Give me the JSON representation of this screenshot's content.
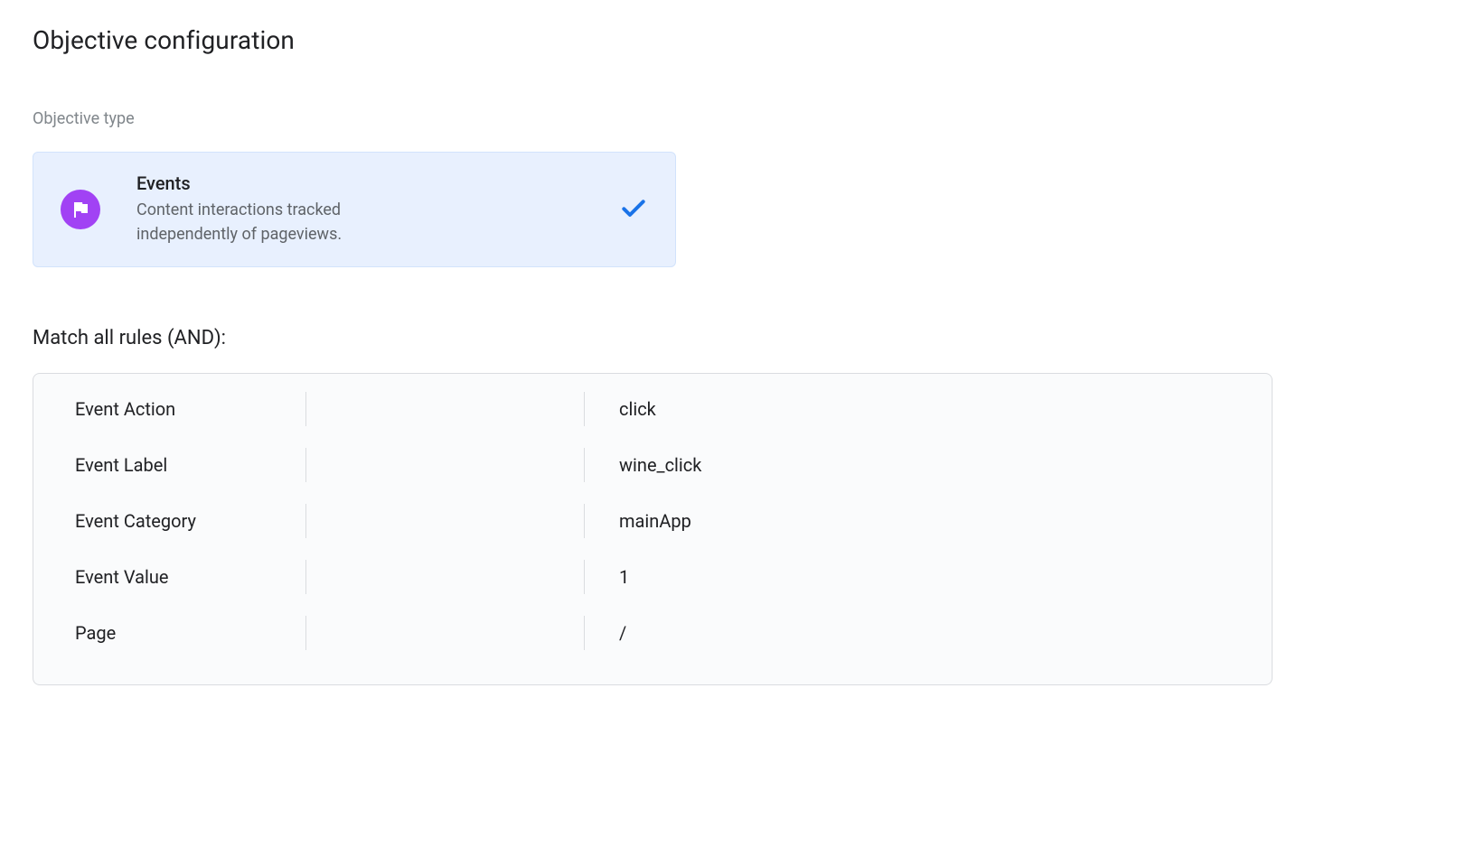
{
  "page_title": "Objective configuration",
  "objective_type": {
    "label": "Objective type",
    "card": {
      "title": "Events",
      "description": "Content interactions tracked independently of pageviews.",
      "icon": "flag-icon",
      "selected": true
    }
  },
  "rules": {
    "heading": "Match all rules (AND):",
    "items": [
      {
        "name": "Event Action",
        "operator": "",
        "value": "click"
      },
      {
        "name": "Event Label",
        "operator": "",
        "value": "wine_click"
      },
      {
        "name": "Event Category",
        "operator": "",
        "value": "mainApp"
      },
      {
        "name": "Event Value",
        "operator": "",
        "value": "1"
      },
      {
        "name": "Page",
        "operator": "",
        "value": "/"
      }
    ]
  }
}
